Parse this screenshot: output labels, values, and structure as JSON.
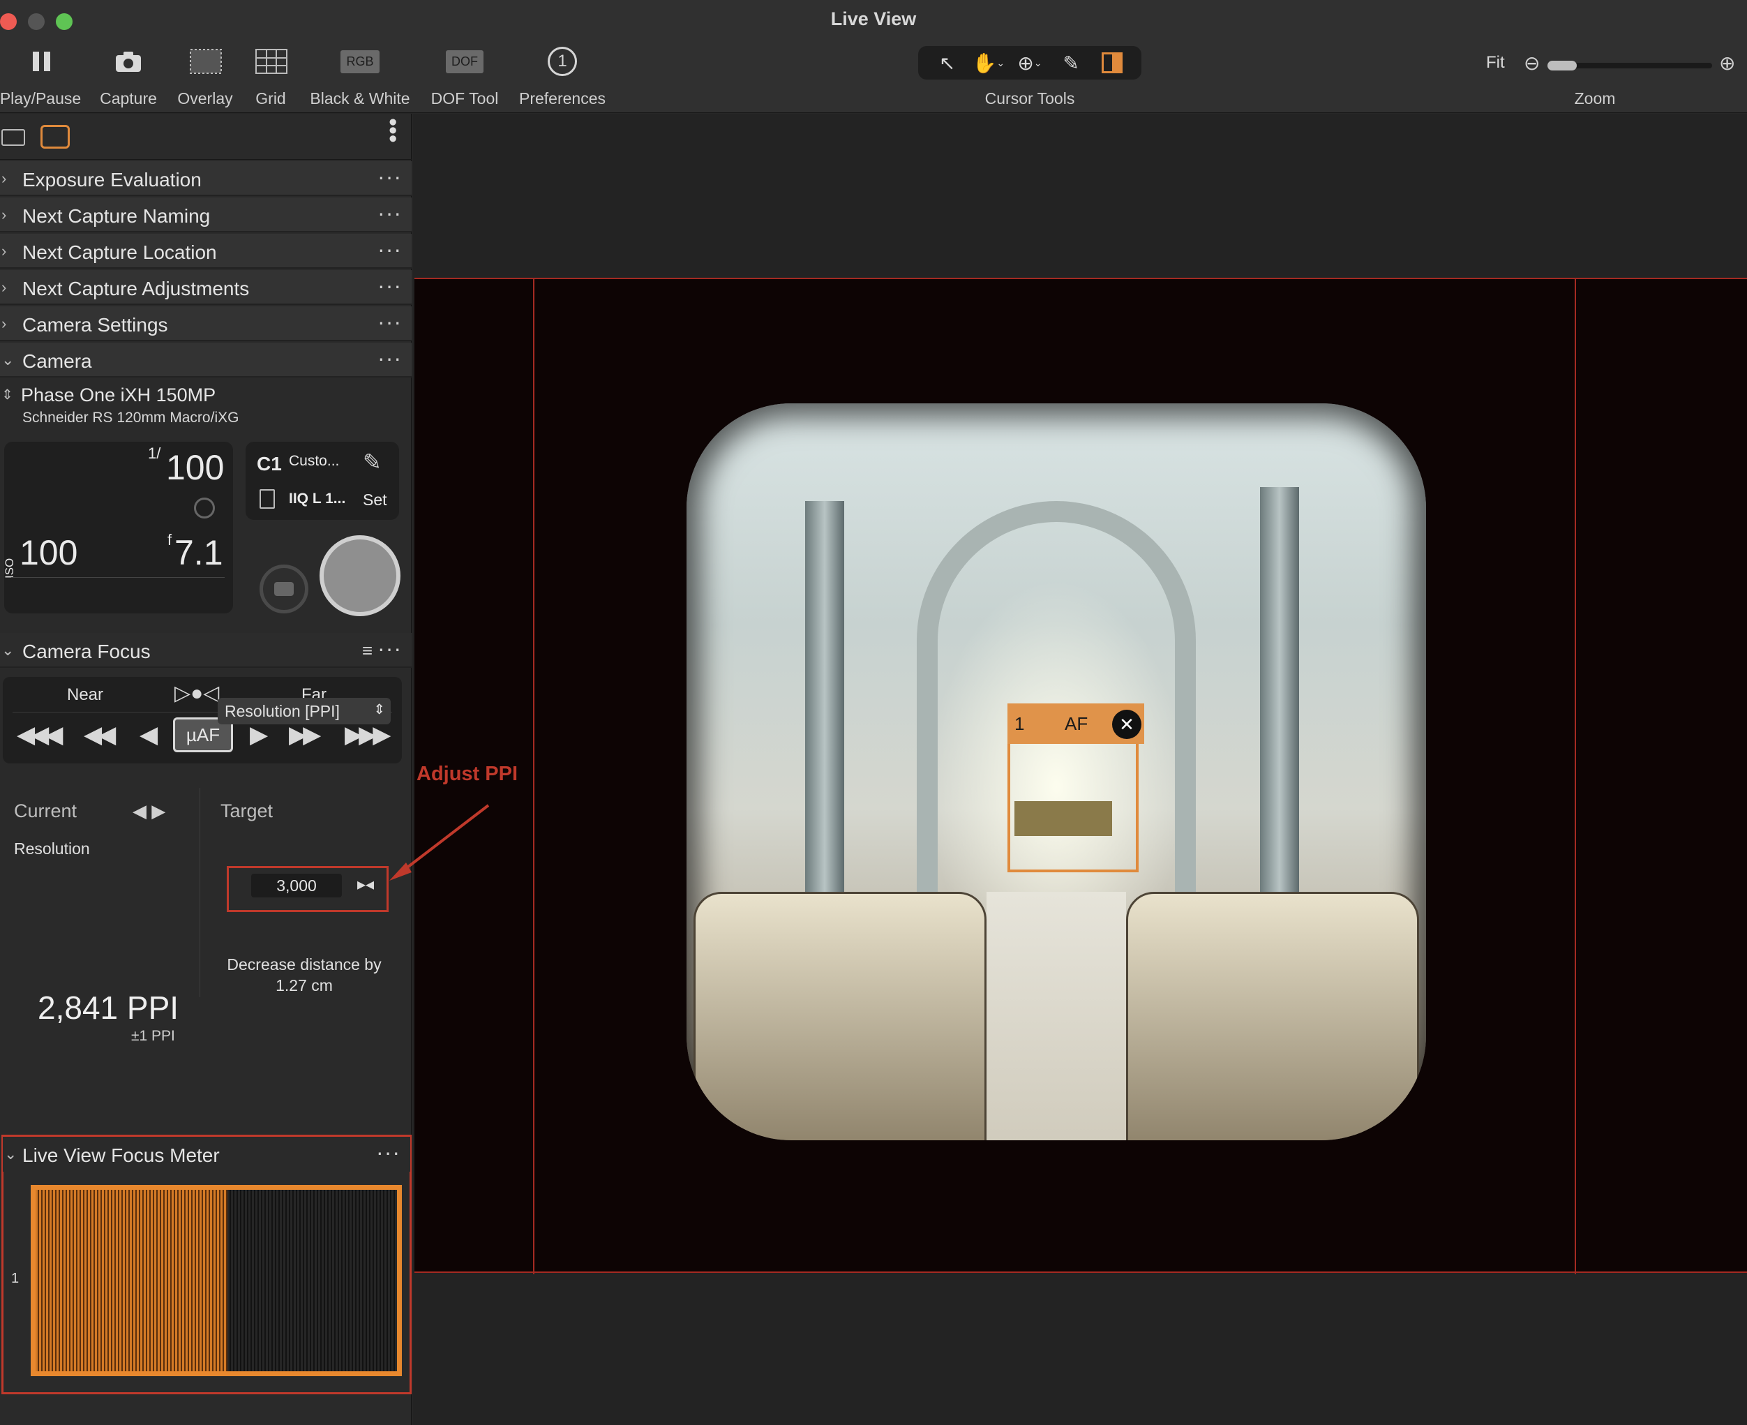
{
  "window": {
    "title": "Live View"
  },
  "colors": {
    "accent": "#E08A3C",
    "annotation_red": "#C0392B",
    "guide_red": "#A42A22"
  },
  "toolbar": {
    "items": [
      {
        "label": "Play/Pause",
        "icon": "pause-icon"
      },
      {
        "label": "Capture",
        "icon": "camera-icon"
      },
      {
        "label": "Overlay",
        "icon": "overlay-icon"
      },
      {
        "label": "Grid",
        "icon": "grid-icon"
      },
      {
        "label": "Black & White",
        "icon": "rgb-icon",
        "badge": "RGB"
      },
      {
        "label": "DOF Tool",
        "icon": "dof-icon",
        "badge": "DOF"
      },
      {
        "label": "Preferences",
        "icon": "info-circle-icon",
        "badge": "1"
      }
    ],
    "cursor_tools_label": "Cursor Tools",
    "zoom_label": "Zoom",
    "zoom_fit": "Fit"
  },
  "sidebar": {
    "panels": [
      {
        "title": "Exposure Evaluation",
        "collapsed": true
      },
      {
        "title": "Next Capture Naming",
        "collapsed": true
      },
      {
        "title": "Next Capture Location",
        "collapsed": true
      },
      {
        "title": "Next Capture Adjustments",
        "collapsed": true
      },
      {
        "title": "Camera Settings",
        "collapsed": true
      },
      {
        "title": "Camera",
        "collapsed": false
      }
    ],
    "camera": {
      "model": "Phase One iXH 150MP",
      "lens": "Schneider RS 120mm Macro/iXG",
      "shutter_prefix": "1/",
      "shutter": "100",
      "iso_label": "ISO",
      "iso": "100",
      "aperture_prefix": "f",
      "aperture": "7.1",
      "mode": "C1",
      "mode_name": "Custo...",
      "format": "IIQ L 1...",
      "set_label": "Set"
    },
    "camera_focus": {
      "title": "Camera Focus",
      "near": "Near",
      "far": "Far",
      "af_button": "µAF"
    },
    "resolution": {
      "current_label": "Current",
      "target_label": "Target",
      "resolution_label": "Resolution",
      "current_value": "2,841 PPI",
      "tolerance": "±1 PPI",
      "target_select": "Resolution [PPI]",
      "target_value": "3,000",
      "advice": "Decrease distance by 1.27 cm"
    },
    "focus_meter": {
      "title": "Live View Focus Meter",
      "row_label": "1",
      "level_fraction": 0.53
    }
  },
  "viewer": {
    "af_point_number": "1",
    "af_point_label": "AF",
    "annotation": "Adjust PPI"
  }
}
